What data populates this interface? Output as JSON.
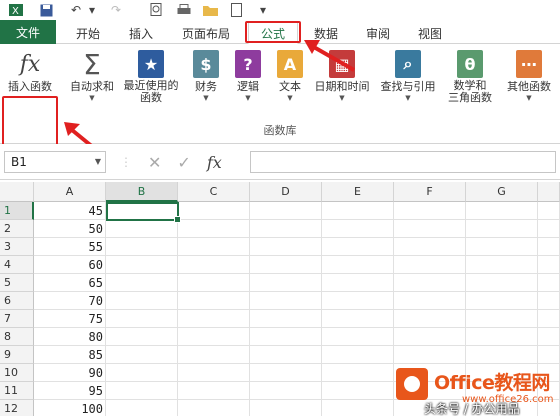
{
  "tabs": {
    "file": "文件",
    "items": [
      "开始",
      "插入",
      "页面布局",
      "公式",
      "数据",
      "审阅",
      "视图"
    ],
    "active": "公式"
  },
  "ribbon": {
    "buttons": [
      {
        "label": "插入函数",
        "icon": "fx-icon"
      },
      {
        "label": "自动求和",
        "icon": "sigma-icon"
      },
      {
        "label": "最近使用的\n函数",
        "icon": "star-book-icon"
      },
      {
        "label": "财务",
        "icon": "coins-icon"
      },
      {
        "label": "逻辑",
        "icon": "question-book-icon"
      },
      {
        "label": "文本",
        "icon": "text-book-icon"
      },
      {
        "label": "日期和时间",
        "icon": "calendar-book-icon"
      },
      {
        "label": "查找与引用",
        "icon": "magnifier-book-icon"
      },
      {
        "label": "数学和\n三角函数",
        "icon": "theta-book-icon"
      },
      {
        "label": "其他函数",
        "icon": "more-book-icon"
      }
    ],
    "group_label": "函数库"
  },
  "formula_bar": {
    "name_box": "B1",
    "cancel": "✕",
    "enter": "✓",
    "fx": "fx",
    "value": ""
  },
  "grid": {
    "columns": [
      "A",
      "B",
      "C",
      "D",
      "E",
      "F",
      "G"
    ],
    "rows": [
      {
        "row": "1",
        "a": "45"
      },
      {
        "row": "2",
        "a": "50"
      },
      {
        "row": "3",
        "a": "55"
      },
      {
        "row": "4",
        "a": "60"
      },
      {
        "row": "5",
        "a": "65"
      },
      {
        "row": "6",
        "a": "70"
      },
      {
        "row": "7",
        "a": "75"
      },
      {
        "row": "8",
        "a": "80"
      },
      {
        "row": "9",
        "a": "85"
      },
      {
        "row": "10",
        "a": "90"
      },
      {
        "row": "11",
        "a": "95"
      },
      {
        "row": "12",
        "a": "100"
      }
    ]
  },
  "watermark": {
    "brand": "Office教程网",
    "site": "www.office26.com",
    "caption": "头条号 / 办公用品"
  },
  "colors": {
    "accent": "#217346",
    "highlight": "#e02020",
    "brand": "#e8561b"
  }
}
